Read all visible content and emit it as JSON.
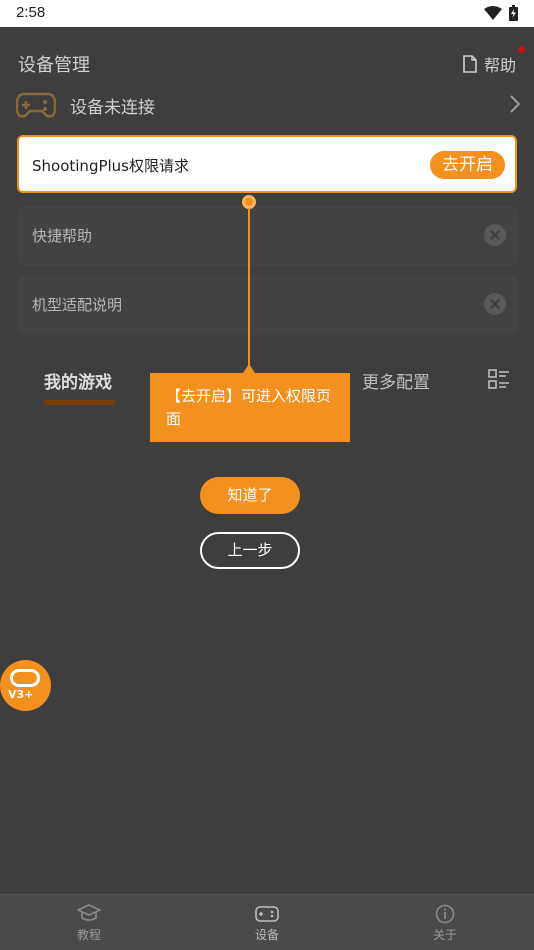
{
  "status_bar": {
    "time": "2:58"
  },
  "header": {
    "title": "设备管理",
    "help_label": "帮助"
  },
  "device": {
    "status_label": "设备未连接"
  },
  "highlight_card": {
    "label": "ShootingPlus权限请求",
    "button_label": "去开启"
  },
  "quick_items": [
    {
      "label": "快捷帮助"
    },
    {
      "label": "机型适配说明"
    }
  ],
  "tabs": [
    {
      "label": "我的游戏",
      "active": true
    },
    {
      "label": "更多配置",
      "active": false
    }
  ],
  "guide": {
    "tooltip_text": "【去开启】可进入权限页面",
    "ok_label": "知道了",
    "prev_label": "上一步"
  },
  "fab": {
    "label": "V3+"
  },
  "bottom_nav": [
    {
      "label": "教程",
      "icon": "graduation-cap-icon"
    },
    {
      "label": "设备",
      "icon": "gamepad-icon"
    },
    {
      "label": "关于",
      "icon": "info-icon"
    }
  ],
  "colors": {
    "accent": "#f4911e",
    "overlay_bg": "#3e3e3e",
    "nav_bg": "#4a4a4a"
  }
}
